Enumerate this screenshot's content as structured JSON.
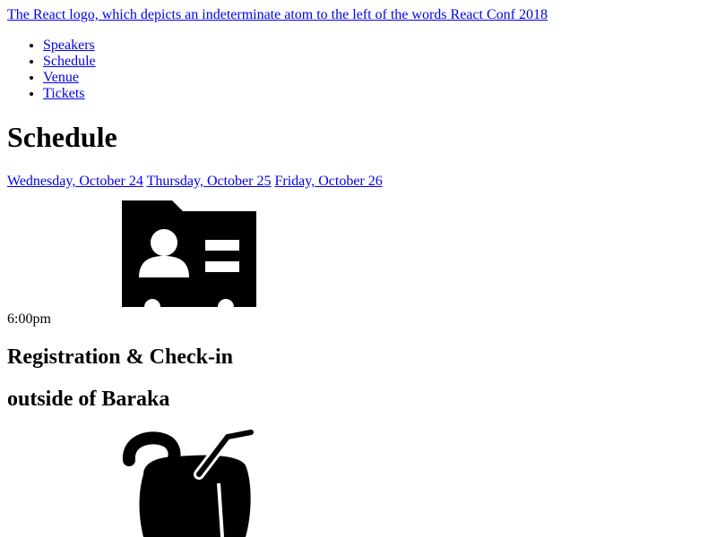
{
  "header": {
    "logo_alt": "The React logo, which depicts an indeterminate atom to the left of the words React Conf 2018"
  },
  "nav": {
    "items": [
      {
        "label": "Speakers"
      },
      {
        "label": "Schedule"
      },
      {
        "label": "Venue"
      },
      {
        "label": "Tickets"
      }
    ]
  },
  "main": {
    "title": "Schedule",
    "days": [
      {
        "label": "Wednesday, October 24"
      },
      {
        "label": "Thursday, October 25"
      },
      {
        "label": "Friday, October 26"
      }
    ],
    "sessions": [
      {
        "icon": "name-badge-icon",
        "time": "6:00pm",
        "title": "Registration & Check-in",
        "location": "outside of Baraka"
      },
      {
        "icon": "coconut-drink-icon"
      }
    ]
  },
  "colors": {
    "link": "#0000ee",
    "text": "#000000",
    "background": "#ffffff"
  }
}
